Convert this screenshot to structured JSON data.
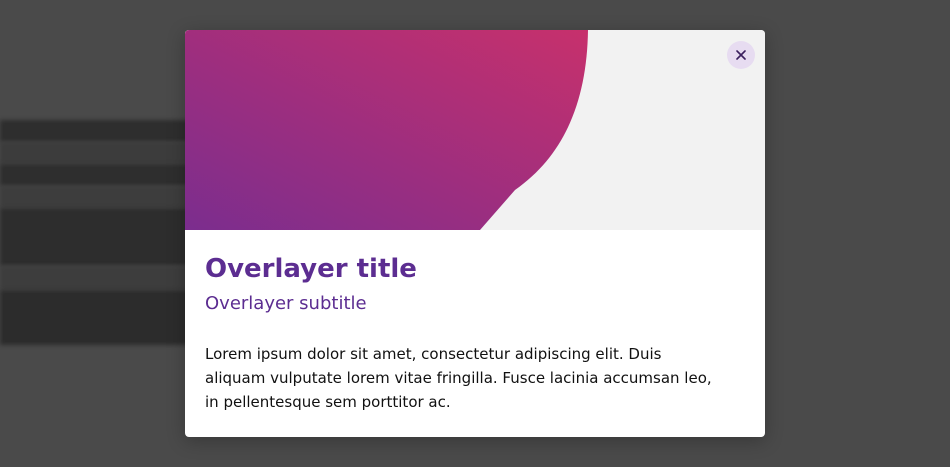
{
  "overlay": {
    "title": "Overlayer title",
    "subtitle": "Overlayer subtitle",
    "body": "Lorem ipsum dolor sit amet, consectetur adipiscing elit. Duis aliquam vulputate lorem vitae fringilla. Fusce lacinia accumsan leo, in pellentesque sem porttitor ac.",
    "close_icon": "close-icon"
  },
  "colors": {
    "gradient_start": "#7b2d8e",
    "gradient_end": "#c7306c",
    "hero_background": "#f2f2f2",
    "title_color": "#5c2d91",
    "close_button_bg": "#e7dcf1",
    "backdrop": "#4a4a4a"
  }
}
